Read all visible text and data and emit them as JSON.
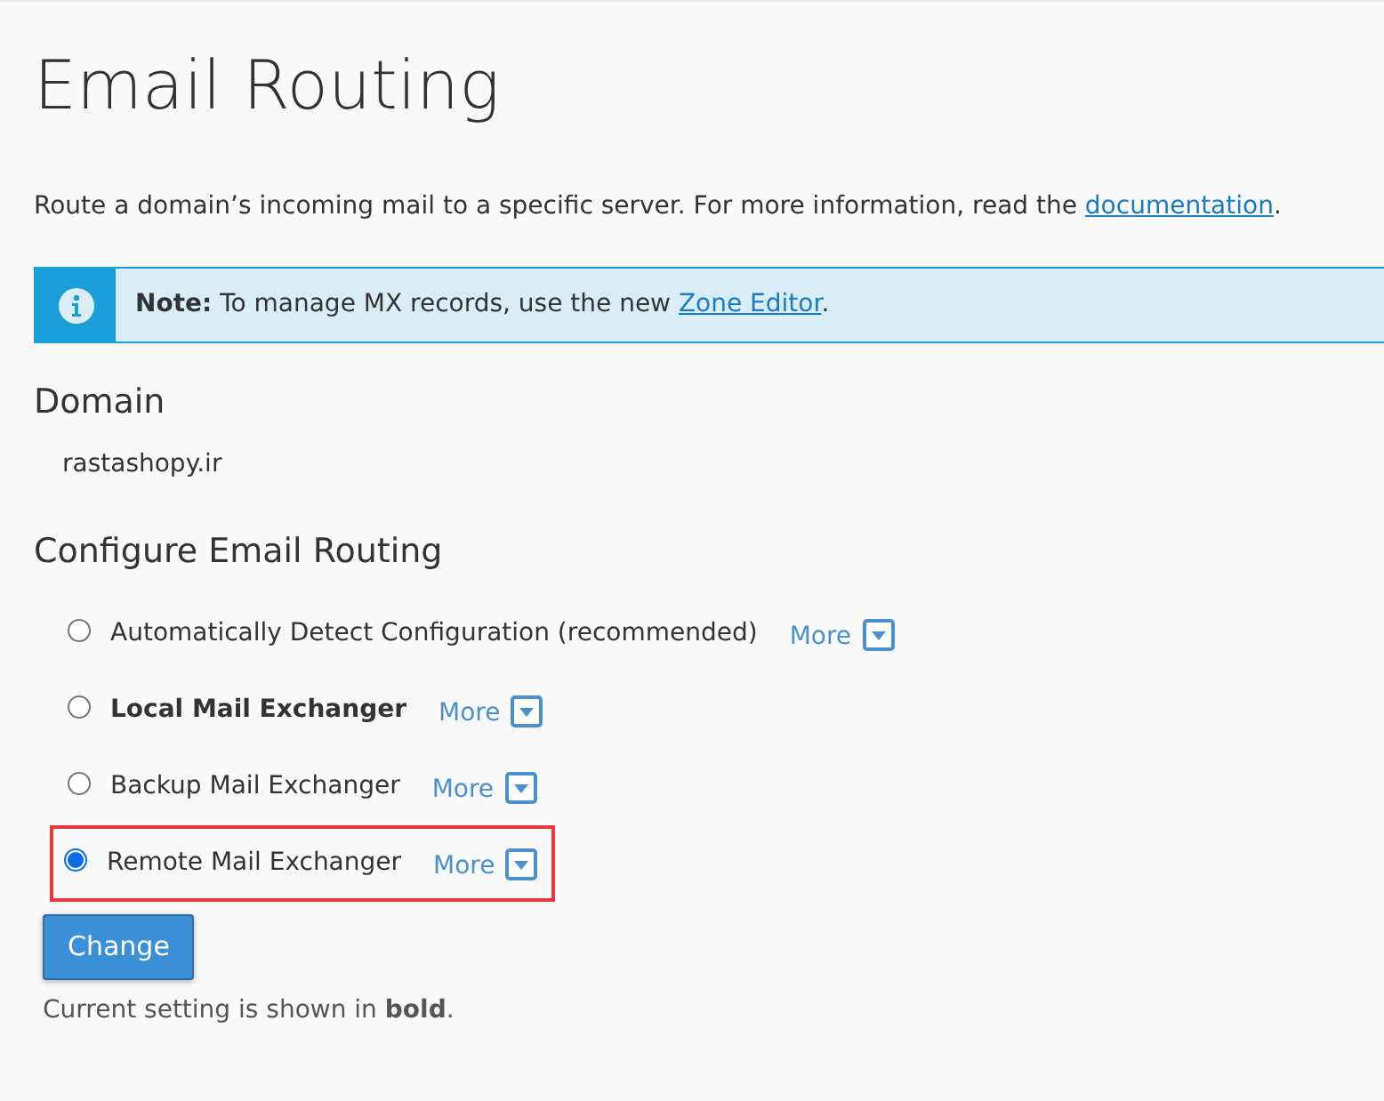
{
  "title": "Email Routing",
  "description": {
    "before": "Route a domain’s incoming mail to a specific server. For more information, read the",
    "link": "documentation",
    "after": "."
  },
  "note": {
    "before": "**Note:** To manage MX records, use the new",
    "link": "Zone Editor",
    "after": "."
  },
  "domain_heading": "Domain",
  "domain": "rastashopy.ir",
  "configure_heading": "Configure Email Routing",
  "options": [
    {
      "label": "Automatically Detect Configuration (recommended)",
      "more": "More",
      "selected": false,
      "current": false,
      "highlighted": false
    },
    {
      "label": "Local Mail Exchanger",
      "more": "More",
      "selected": false,
      "current": true,
      "highlighted": false
    },
    {
      "label": "Backup Mail Exchanger",
      "more": "More",
      "selected": false,
      "current": false,
      "highlighted": false
    },
    {
      "label": "Remote Mail Exchanger",
      "more": "More",
      "selected": true,
      "current": false,
      "highlighted": true
    }
  ],
  "change_button": "Change",
  "footer": "Current setting is shown in **bold**."
}
